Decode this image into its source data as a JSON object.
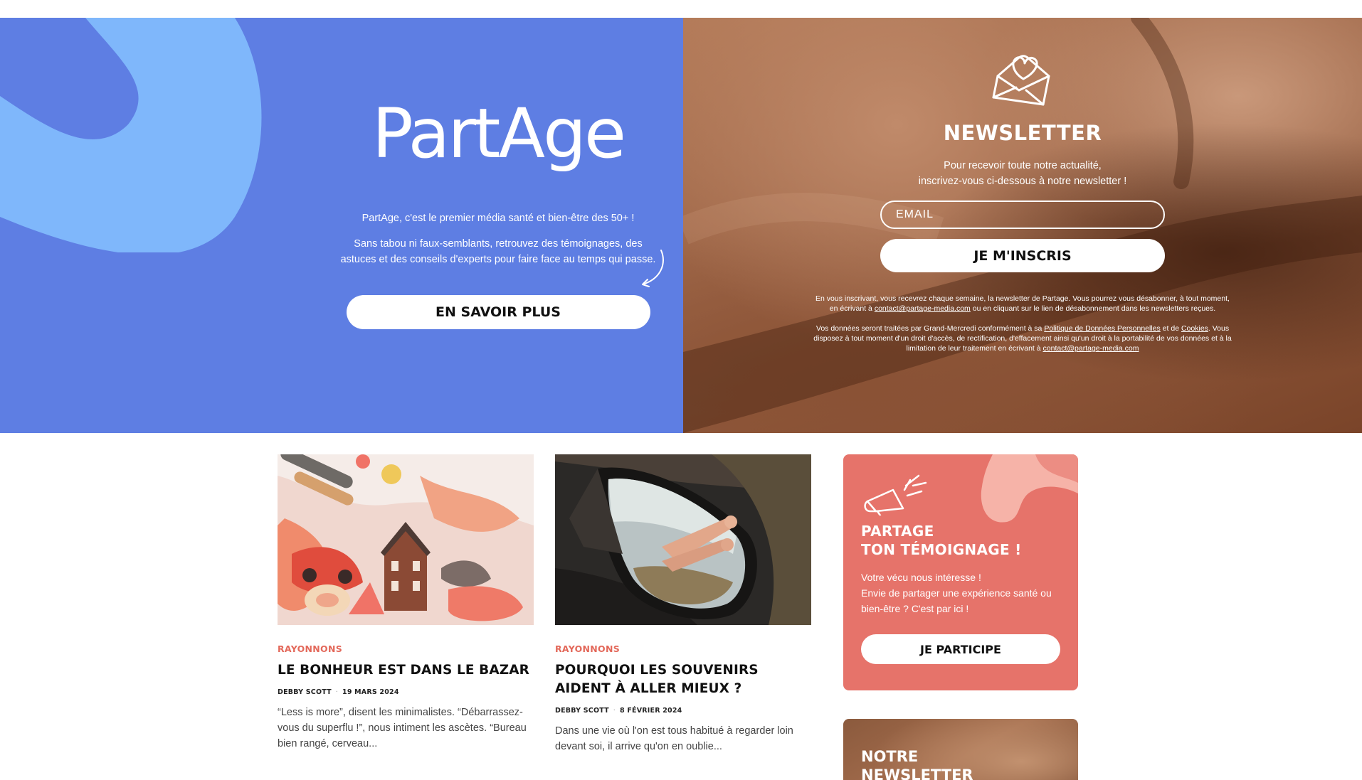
{
  "hero": {
    "logo": "PartAge",
    "intro": "PartAge, c'est le premier média santé et bien-être des 50+ !",
    "description": "Sans tabou ni faux-semblants, retrouvez des témoignages, des astuces et des conseils d'experts pour faire face au temps qui passe.",
    "cta_label": "EN SAVOIR PLUS",
    "color_bg": "#5e7ee3",
    "color_blob": "#7fb7fb"
  },
  "newsletter": {
    "icon": "envelope-heart-icon",
    "title": "NEWSLETTER",
    "subtitle_line1": "Pour recevoir toute notre actualité,",
    "subtitle_line2": "inscrivez-vous ci-dessous à notre newsletter !",
    "email_placeholder": "EMAIL",
    "submit_label": "JE M'INSCRIS",
    "legal1_a": "En vous inscrivant, vous recevrez chaque semaine, la newsletter de Partage. Vous pourrez vous désabonner, à tout moment, en écrivant à ",
    "legal1_email": "contact@partage-media.com",
    "legal1_b": " ou en cliquant sur le lien de désabonnement dans les newsletters reçues.",
    "legal2_a": "Vos données seront traitées par Grand-Mercredi conformément à sa ",
    "legal2_link1": "Politique de Données Personnelles",
    "legal2_b": " et de ",
    "legal2_link2": "Cookies",
    "legal2_c": ". Vous disposez à tout moment d'un droit d'accès, de rectification, d'effacement ainsi qu'un droit à la portabilité de vos données et à la limitation de leur traitement en écrivant à ",
    "legal2_email": "contact@partage-media.com"
  },
  "articles": [
    {
      "category": "RAYONNONS",
      "title": "LE BONHEUR EST DANS LE BAZAR",
      "author": "DEBBY SCOTT",
      "date": "19 MARS 2024",
      "excerpt": "“Less is more”, disent les minimalistes. “Débarrassez-vous du superflu !”, nous intiment les ascètes. “Bureau bien rangé, cerveau..."
    },
    {
      "category": "RAYONNONS",
      "title": "POURQUOI LES SOUVENIRS AIDENT À ALLER MIEUX ?",
      "author": "DEBBY SCOTT",
      "date": "8 FÉVRIER 2024",
      "excerpt": "Dans une vie où l'on est tous habitué à regarder loin devant soi, il arrive qu'on en oublie..."
    }
  ],
  "sidebar": {
    "temoignage": {
      "icon": "megaphone-icon",
      "title_line1": "PARTAGE",
      "title_line2": "TON TÉMOIGNAGE !",
      "text_line1": "Votre vécu nous intéresse !",
      "text_line2": "Envie de partager une expérience santé ou bien-être ? C'est par ici !",
      "cta_label": "JE PARTICIPE",
      "color_bg": "#e6736a"
    },
    "newsletter_card": {
      "title_line1": "NOTRE",
      "title_line2": "NEWSLETTER"
    }
  }
}
